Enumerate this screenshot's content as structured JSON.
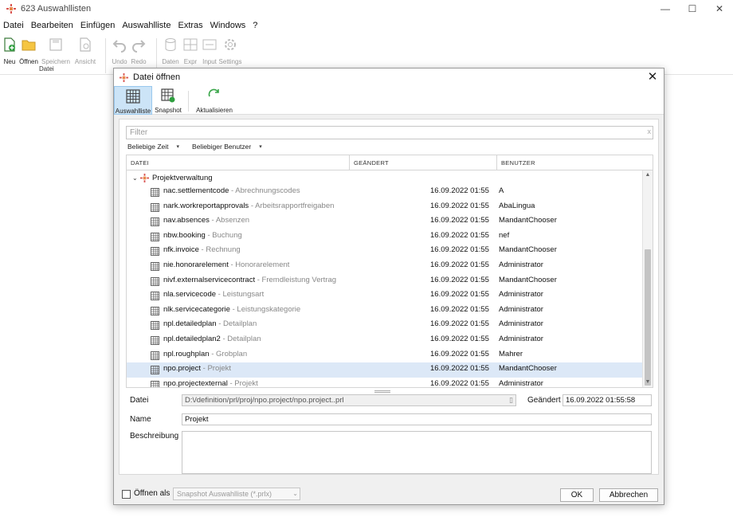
{
  "app": {
    "title": "623 Auswahllisten",
    "minimize": "—",
    "maximize": "☐",
    "close": "✕"
  },
  "menu": [
    {
      "label": "Datei"
    },
    {
      "label": "Bearbeiten"
    },
    {
      "label": "Einfügen"
    },
    {
      "label": "Auswahlliste"
    },
    {
      "label": "Extras"
    },
    {
      "label": "Windows"
    },
    {
      "label": "?"
    }
  ],
  "ribbon": {
    "buttons": [
      {
        "label": "Neu",
        "icon": "new-file-icon",
        "enabled": true
      },
      {
        "label": "Öffnen",
        "icon": "folder-open-icon",
        "enabled": true
      },
      {
        "label": "Speichern",
        "icon": "save-icon",
        "enabled": false
      },
      {
        "label": "Ansicht",
        "icon": "preview-icon",
        "enabled": false
      },
      {
        "label": "Undo",
        "icon": "undo-icon",
        "enabled": false
      },
      {
        "label": "Redo",
        "icon": "redo-icon",
        "enabled": false
      },
      {
        "label": "Daten",
        "icon": "database-icon",
        "enabled": false
      },
      {
        "label": "Expr",
        "icon": "expression-icon",
        "enabled": false
      },
      {
        "label": "Input",
        "icon": "input-icon",
        "enabled": false
      },
      {
        "label": "Settings",
        "icon": "gear-icon",
        "enabled": false
      }
    ],
    "group_datei": "Datei"
  },
  "dialog": {
    "title": "Datei öffnen",
    "close": "✕",
    "toolbar": [
      {
        "label": "Auswahlliste",
        "icon": "grid-icon",
        "active": true
      },
      {
        "label": "Snapshot",
        "icon": "snapshot-icon",
        "active": false
      },
      {
        "label": "Aktualisieren",
        "icon": "refresh-icon",
        "active": false
      }
    ],
    "filter_placeholder": "Filter",
    "filter_clear": "x",
    "dropdowns": [
      {
        "label": "Beliebige Zeit"
      },
      {
        "label": "Beliebiger Benutzer"
      }
    ],
    "columns": [
      "DATEI",
      "GEÄNDERT",
      "BENUTZER"
    ],
    "group": "Projektverwaltung",
    "rows": [
      {
        "name": "nac.settlementcode",
        "desc": " - Abrechnungscodes",
        "date": "16.09.2022  01:55",
        "user": "A"
      },
      {
        "name": "nark.workreportapprovals",
        "desc": " - Arbeitsrapportfreigaben",
        "date": "16.09.2022  01:55",
        "user": "AbaLingua"
      },
      {
        "name": "nav.absences",
        "desc": " - Absenzen",
        "date": "16.09.2022  01:55",
        "user": "MandantChooser"
      },
      {
        "name": "nbw.booking",
        "desc": " - Buchung",
        "date": "16.09.2022  01:55",
        "user": "nef"
      },
      {
        "name": "nfk.invoice",
        "desc": " - Rechnung",
        "date": "16.09.2022  01:55",
        "user": "MandantChooser"
      },
      {
        "name": "nie.honorarelement",
        "desc": " - Honorarelement",
        "date": "16.09.2022  01:55",
        "user": "Administrator"
      },
      {
        "name": "nivf.externalservicecontract",
        "desc": " - Fremdleistung Vertrag",
        "date": "16.09.2022  01:55",
        "user": "MandantChooser"
      },
      {
        "name": "nla.servicecode",
        "desc": " - Leistungsart",
        "date": "16.09.2022  01:55",
        "user": "Administrator"
      },
      {
        "name": "nlk.servicecategorie",
        "desc": " - Leistungskategorie",
        "date": "16.09.2022  01:55",
        "user": "Administrator"
      },
      {
        "name": "npl.detailedplan",
        "desc": " - Detailplan",
        "date": "16.09.2022  01:55",
        "user": "Administrator"
      },
      {
        "name": "npl.detailedplan2",
        "desc": " - Detailplan",
        "date": "16.09.2022  01:55",
        "user": "Administrator"
      },
      {
        "name": "npl.roughplan",
        "desc": " - Grobplan",
        "date": "16.09.2022  01:55",
        "user": "Mahrer"
      },
      {
        "name": "npo.project",
        "desc": " - Projekt",
        "date": "16.09.2022  01:55",
        "user": "MandantChooser",
        "selected": true
      },
      {
        "name": "npo.projectexternal",
        "desc": " - Projekt",
        "date": "16.09.2022  01:55",
        "user": "Administrator"
      }
    ],
    "fields": {
      "datei_label": "Datei",
      "datei_value": "D:\\/definition/prl/proj/npo.project/npo.project..prl",
      "geaendert_label": "Geändert",
      "geaendert_value": "16.09.2022 01:55:58",
      "name_label": "Name",
      "name_value": "Projekt",
      "beschreibung_label": "Beschreibung",
      "beschreibung_value": ""
    },
    "open_as_label": "Öffnen als",
    "open_as_value": "Snapshot Auswahlliste (*.prlx)",
    "ok_label": "OK",
    "cancel_label": "Abbrechen"
  }
}
